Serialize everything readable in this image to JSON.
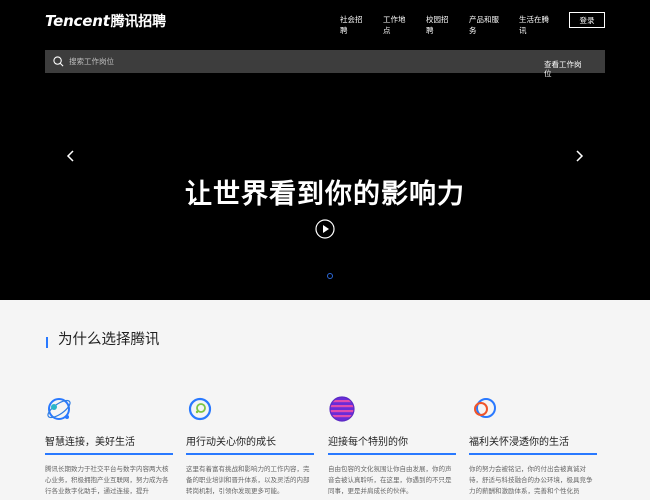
{
  "header": {
    "logo_en": "Tencent",
    "logo_cn": "腾讯招聘",
    "nav": [
      {
        "label": "社会招聘"
      },
      {
        "label": "工作地点"
      },
      {
        "label": "校园招聘"
      },
      {
        "label": "产品和服务"
      },
      {
        "label": "生活在腾讯"
      }
    ],
    "login_label": "登录"
  },
  "search": {
    "placeholder": "搜索工作岗位",
    "button_label": "查看工作岗位"
  },
  "hero": {
    "slogan": "让世界看到你的影响力"
  },
  "why": {
    "title": "为什么选择腾讯",
    "cards": [
      {
        "title": "智慧连接，美好生活",
        "desc": "腾讯长期致力于社交平台与数字内容两大核心业务，积极拥抱产业互联网，努力成为各行各业数字化助手，通过连接，提升",
        "icon": "globe-orbit-icon"
      },
      {
        "title": "用行动关心你的成长",
        "desc": "这里有着富有挑战和影响力的工作内容，完备的职业培训和晋升体系，以及灵活的内部转岗机制，引领你发现更多可能。",
        "icon": "growth-ring-icon"
      },
      {
        "title": "迎接每个特别的你",
        "desc": "自由包容的文化氛围让你自由发展，你的声音会被认真聆听，在这里，你遇到的不只是同事，更是并肩成长的伙伴。",
        "icon": "striped-sphere-icon"
      },
      {
        "title": "福利关怀浸透你的生活",
        "desc": "你的努力会被铭记，你的付出会被真诚对待，舒适与科技融合的办公环境，极具竞争力的薪酬和激励体系，完善和个性化员",
        "icon": "double-ring-icon"
      }
    ]
  },
  "colors": {
    "accent": "#2979ff",
    "hero_bg": "#000000",
    "search_bg": "#3d3d3d"
  }
}
